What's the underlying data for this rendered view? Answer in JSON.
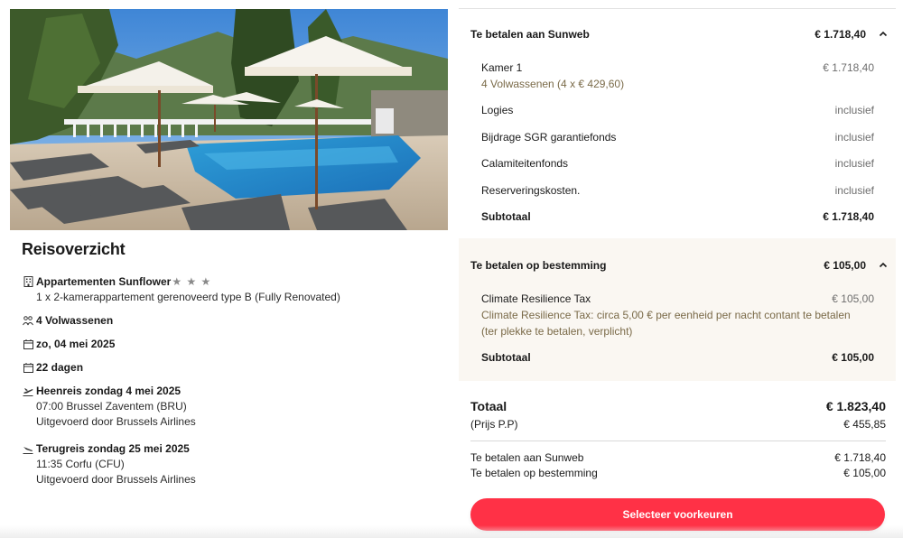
{
  "hero_image": {
    "alt_name": "hotel-pool-photo"
  },
  "overview": {
    "title": "Reisoverzicht",
    "accommodation": {
      "name": "Appartementen Sunflower",
      "stars": "★ ★ ★",
      "room": "1 x 2-kamerappartement gerenoveerd type B (Fully Renovated)"
    },
    "travelers": "4 Volwassenen",
    "date": "zo, 04 mei 2025",
    "duration": "22 dagen",
    "outbound": {
      "title": "Heenreis zondag 4 mei 2025",
      "line1": "07:00 Brussel Zaventem (BRU)",
      "line2": "Uitgevoerd door Brussels Airlines"
    },
    "return": {
      "title": "Terugreis zondag 25 mei 2025",
      "line1": "11:35 Corfu (CFU)",
      "line2": "Uitgevoerd door Brussels Airlines"
    }
  },
  "sunweb": {
    "title": "Te betalen aan Sunweb",
    "amount": "€ 1.718,40",
    "room_label": "Kamer 1",
    "room_amount": "€ 1.718,40",
    "room_note": "4 Volwassenen (4 x € 429,60)",
    "items": [
      {
        "label": "Logies",
        "value": "inclusief"
      },
      {
        "label": "Bijdrage SGR garantiefonds",
        "value": "inclusief"
      },
      {
        "label": "Calamiteitenfonds",
        "value": "inclusief"
      },
      {
        "label": "Reserveringskosten.",
        "value": "inclusief"
      }
    ],
    "subtotal_label": "Subtotaal",
    "subtotal_value": "€ 1.718,40"
  },
  "destination": {
    "title": "Te betalen op bestemming",
    "amount": "€ 105,00",
    "tax_label": "Climate Resilience Tax",
    "tax_amount": "€ 105,00",
    "tax_note": "Climate Resilience Tax: circa 5,00 € per eenheid per nacht contant te betalen (ter plekke te betalen, verplicht)",
    "subtotal_label": "Subtotaal",
    "subtotal_value": "€ 105,00"
  },
  "totals": {
    "total_label": "Totaal",
    "total_value": "€ 1.823,40",
    "pp_label": "(Prijs P.P)",
    "pp_value": "€ 455,85",
    "sunweb_label": "Te betalen aan Sunweb",
    "sunweb_value": "€ 1.718,40",
    "dest_label": "Te betalen op bestemming",
    "dest_value": "€ 105,00"
  },
  "cta_label": "Selecteer voorkeuren",
  "colors": {
    "cta": "#ff3146",
    "dest_bg": "#faf7f2",
    "note": "#7a6a48"
  }
}
